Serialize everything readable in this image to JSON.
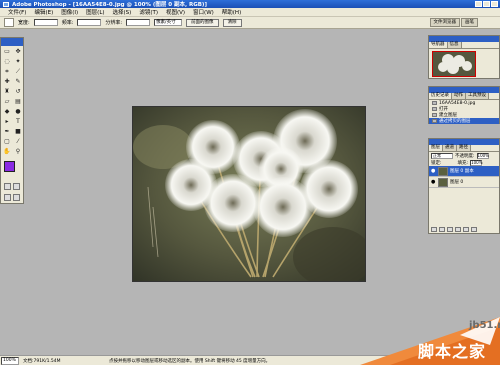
{
  "window": {
    "title": "Adobe Photoshop - [16AA54E8-0.jpg @ 100% (图层 0 副本, RGB)]"
  },
  "menus": [
    "文件(F)",
    "编辑(E)",
    "图像(I)",
    "图层(L)",
    "选择(S)",
    "滤镜(T)",
    "视图(V)",
    "窗口(W)",
    "帮助(H)"
  ],
  "options_bar": {
    "feather_label": "宽度:",
    "contrast_label": "频率:",
    "frequency_label": "分辨率:",
    "mode_value": "像素/英寸",
    "front_image_button": "前面的图像",
    "clear_button": "清除"
  },
  "palette_well": {
    "tabs": [
      "文件浏览器",
      "画笔"
    ]
  },
  "navigator": {
    "tabs": [
      "导航器",
      "信息"
    ]
  },
  "history": {
    "tabs": [
      "历史记录",
      "动作",
      "工具预设"
    ],
    "items": [
      "16AA54E8-0.jpg",
      "打开",
      "建立图层",
      "通过拷贝的图层"
    ],
    "selected_index": 3
  },
  "layers": {
    "tabs": [
      "图层",
      "通道",
      "路径"
    ],
    "blend_mode": "正常",
    "opacity_label": "不透明度:",
    "opacity_value": "100%",
    "lock_label": "锁定:",
    "fill_label": "填充:",
    "fill_value": "100%",
    "items": [
      {
        "name": "图层 0 副本",
        "selected": true
      },
      {
        "name": "图层 0",
        "selected": false
      }
    ]
  },
  "status": {
    "zoom": "100%",
    "doc_info": "文档:791K/1.54M",
    "hint": "点按并拖移以移动图层或移动选区的副本。使用 Shift 键将移动 45 度增量方向。"
  },
  "watermark": {
    "site": "jb51.net",
    "cn": "脚本之家"
  },
  "colors": {
    "foreground": "#8a2be2",
    "background": "#ffffff",
    "title_blue": "#2d6fd9"
  }
}
